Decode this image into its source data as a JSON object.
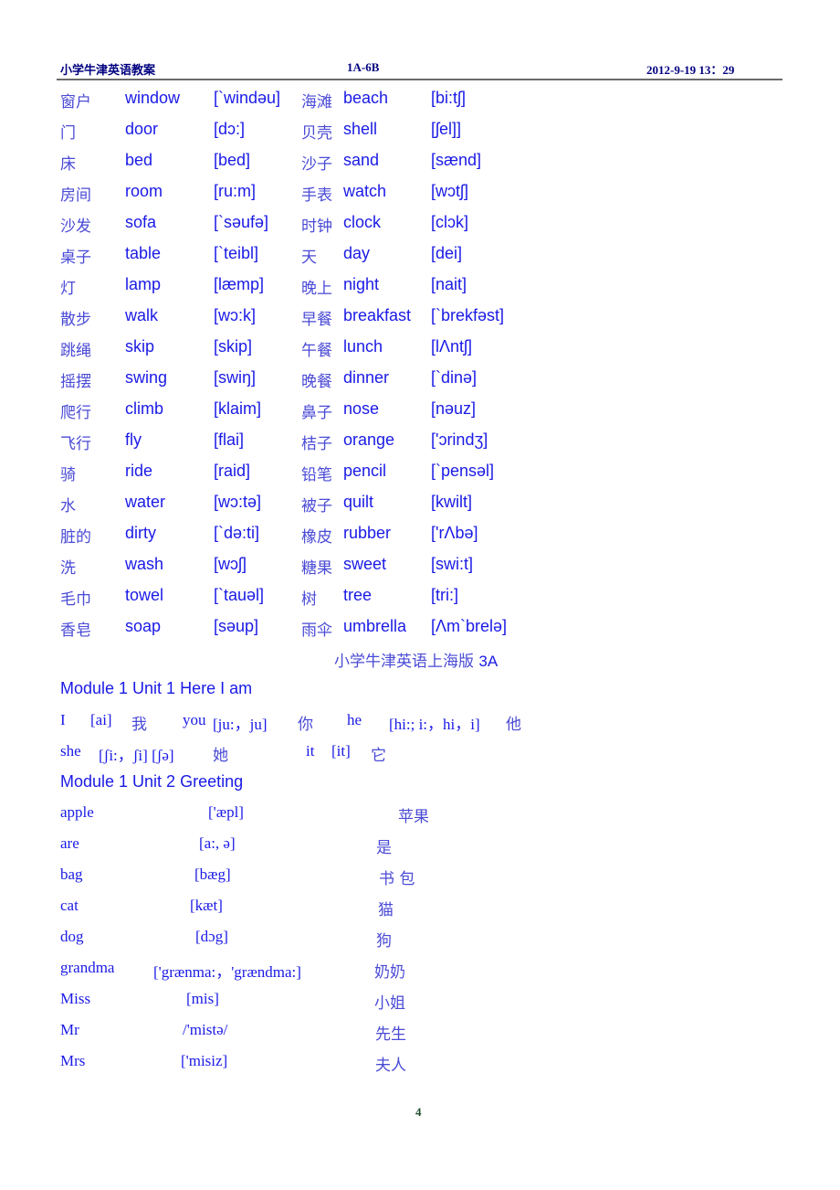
{
  "header": {
    "left": "小学牛津英语教案",
    "middle": "1A-6B",
    "right": "2012-9-19 13：29"
  },
  "vocab_table": [
    {
      "zh1": "窗户",
      "en1": "window",
      "ph1": "[`windəu]",
      "zh2": "海滩",
      "en2": "beach",
      "ph2": "[bi:tʃ]"
    },
    {
      "zh1": "门",
      "en1": "door",
      "ph1": "[dɔ:]",
      "zh2": "贝壳",
      "en2": "shell",
      "ph2": "[ʃel]]"
    },
    {
      "zh1": "床",
      "en1": "bed",
      "ph1": "[bed]",
      "zh2": "沙子",
      "en2": "sand",
      "ph2": "[sænd]"
    },
    {
      "zh1": "房间",
      "en1": "room",
      "ph1": "[ru:m]",
      "zh2": "手表",
      "en2": "watch",
      "ph2": "[wɔtʃ]"
    },
    {
      "zh1": "沙发",
      "en1": "sofa",
      "ph1": "[`səufə]",
      "zh2": "时钟",
      "en2": "clock",
      "ph2": "[clɔk]"
    },
    {
      "zh1": "桌子",
      "en1": "table",
      "ph1": "[`teibl]",
      "zh2": "天",
      "en2": "day",
      "ph2": "[dei]"
    },
    {
      "zh1": "灯",
      "en1": "lamp",
      "ph1": "[læmp]",
      "zh2": "晚上",
      "en2": "night",
      "ph2": "[nait]"
    },
    {
      "zh1": "散步",
      "en1": "walk",
      "ph1": "[wɔ:k]",
      "zh2": "早餐",
      "en2": "breakfast",
      "ph2": "[`brekfəst]"
    },
    {
      "zh1": "跳绳",
      "en1": "skip",
      "ph1": "[skip]",
      "zh2": "午餐",
      "en2": "lunch",
      "ph2": "[lΛntʃ]"
    },
    {
      "zh1": "摇摆",
      "en1": "swing",
      "ph1": "[swiŋ]",
      "zh2": "晚餐",
      "en2": "dinner",
      "ph2": "[`dinə]"
    },
    {
      "zh1": "爬行",
      "en1": "climb",
      "ph1": "[klaim]",
      "zh2": "鼻子",
      "en2": "nose",
      "ph2": "[nəuz]"
    },
    {
      "zh1": "飞行",
      "en1": "fly",
      "ph1": "[flai]",
      "zh2": "桔子",
      "en2": "orange",
      "ph2": "['ɔrindʒ]"
    },
    {
      "zh1": "骑",
      "en1": "ride",
      "ph1": "[raid]",
      "zh2": "铅笔",
      "en2": "pencil",
      "ph2": "[`pensəl]"
    },
    {
      "zh1": "水",
      "en1": "water",
      "ph1": "[wɔ:tə]",
      "zh2": "被子",
      "en2": "quilt",
      "ph2": "[kwilt]"
    },
    {
      "zh1": "脏的",
      "en1": "dirty",
      "ph1": "[`də:ti]",
      "zh2": "橡皮",
      "en2": "rubber",
      "ph2": "['rΛbə]"
    },
    {
      "zh1": "洗",
      "en1": "wash",
      "ph1": "[wɔʃ]",
      "zh2": "糖果",
      "en2": "sweet",
      "ph2": "[swi:t]"
    },
    {
      "zh1": "毛巾",
      "en1": "towel",
      "ph1": "[`tauəl]",
      "zh2": "树",
      "en2": "tree",
      "ph2": "[tri:]"
    },
    {
      "zh1": "香皂",
      "en1": "soap",
      "ph1": "[səup]",
      "zh2": "雨伞",
      "en2": "umbrella",
      "ph2": "[Λm`brelə]"
    }
  ],
  "section_title": {
    "zh": "小学牛津英语上海版 ",
    "latin": "3A"
  },
  "module1_unit1": {
    "title": "Module 1 Unit 1 Here I am",
    "row1": [
      {
        "word": "I",
        "ph": "[ai]",
        "zh": "我"
      },
      {
        "word": "you",
        "ph": "[ju:，ju]",
        "zh": "你"
      },
      {
        "word": "he",
        "ph": "[hi:; i:，hi，i]",
        "zh": "他"
      }
    ],
    "row2": [
      {
        "word": "she",
        "ph": "[ʃi:，ʃi] [ʃə]",
        "zh": "她"
      },
      {
        "word": "it",
        "ph": "[it]",
        "zh": "它"
      }
    ]
  },
  "module1_unit2": {
    "title": "Module 1 Unit 2 Greeting",
    "words": [
      {
        "en": "apple",
        "ph": "['æpl]",
        "zh": "苹果"
      },
      {
        "en": "are",
        "ph": "[a:, ə]",
        "zh": "是"
      },
      {
        "en": "bag",
        "ph": "[bæg]",
        "zh": "书 包"
      },
      {
        "en": "cat",
        "ph": "[kæt]",
        "zh": "猫"
      },
      {
        "en": "dog",
        "ph": "[dɔg]",
        "zh": "狗"
      },
      {
        "en": "grandma",
        "ph": "['grænma:，'grændma:]",
        "zh": "奶奶"
      },
      {
        "en": "Miss",
        "ph": "[mis]",
        "zh": "小姐"
      },
      {
        "en": "Mr",
        "ph": "/'mistə/",
        "zh": "先生"
      },
      {
        "en": "Mrs",
        "ph": "['misiz]",
        "zh": "夫人"
      }
    ]
  },
  "page_number": "4"
}
